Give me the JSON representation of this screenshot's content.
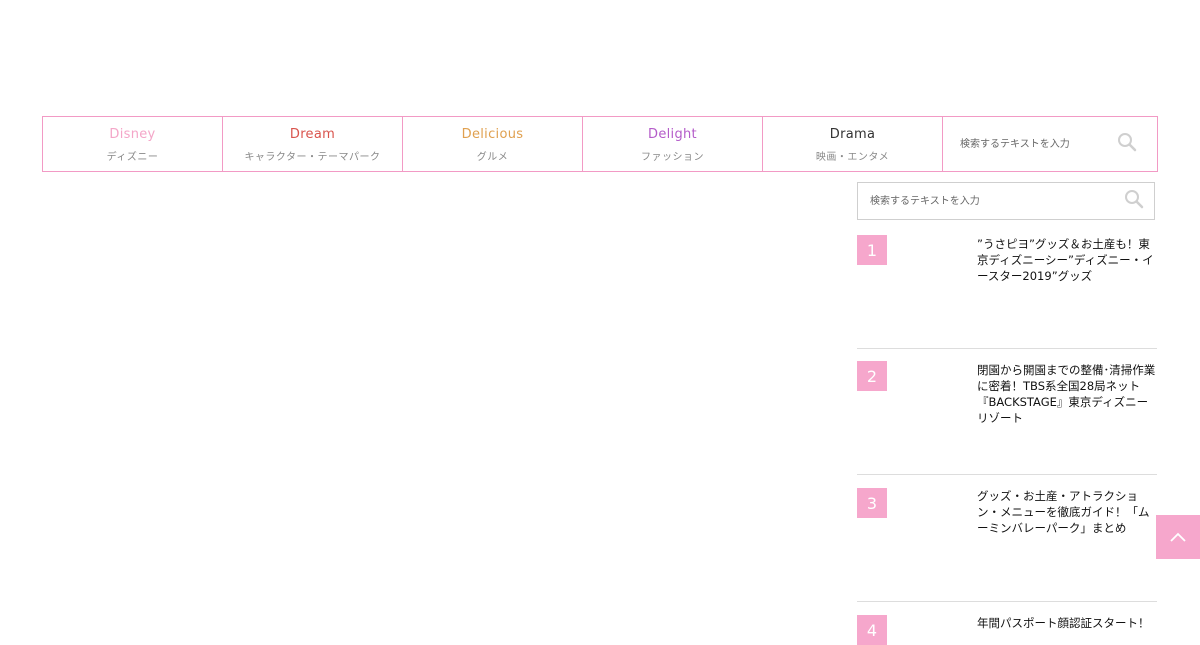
{
  "colors": {
    "border_pink": "#f29ac5",
    "badge_pink": "#f6a7cc"
  },
  "nav": {
    "items": [
      {
        "label": "Disney",
        "sublabel": "ディズニー",
        "color": "#f4a6c8"
      },
      {
        "label": "Dream",
        "sublabel": "キャラクター・テーマパーク",
        "color": "#d9544d"
      },
      {
        "label": "Delicious",
        "sublabel": "グルメ",
        "color": "#e0a04f"
      },
      {
        "label": "Delight",
        "sublabel": "ファッション",
        "color": "#b45cc9"
      },
      {
        "label": "Drama",
        "sublabel": "映画・エンタメ",
        "color": "#333333"
      }
    ],
    "search_placeholder": "検索するテキストを入力",
    "search_icon": "search-icon"
  },
  "sidebar": {
    "search_placeholder": "検索するテキストを入力",
    "ranking": [
      {
        "rank": "1",
        "title": "”うさピヨ”グッズ＆お土産も！東京ディズニーシー”ディズニー・イースター2019”グッズ"
      },
      {
        "rank": "2",
        "title": "閉園から開園までの整備･清掃作業に密着！TBS系全国28局ネット『BACKSTAGE』東京ディズニーリゾート"
      },
      {
        "rank": "3",
        "title": "グッズ・お土産・アトラクション・メニューを徹底ガイド！「ムーミンバレーパーク」まとめ"
      },
      {
        "rank": "4",
        "title": "年間パスポート顔認証スタート！"
      }
    ]
  },
  "back_to_top_icon": "chevron-up-icon"
}
